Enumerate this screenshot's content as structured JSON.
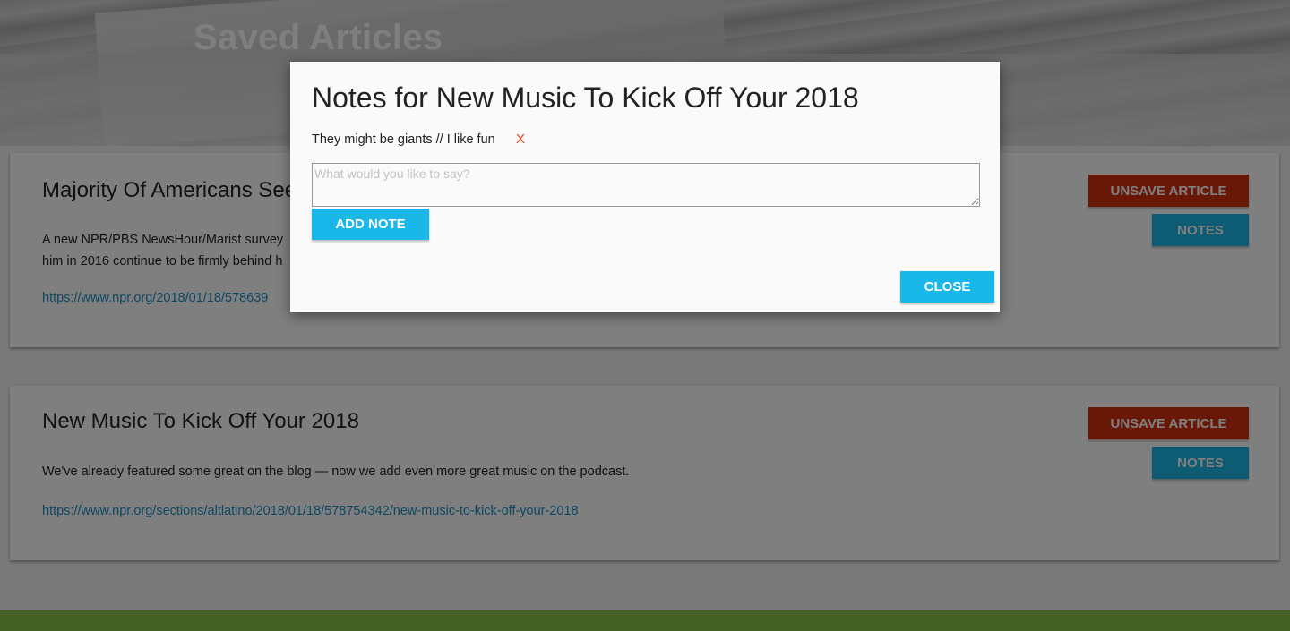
{
  "header": {
    "title": "Saved Articles"
  },
  "articles": [
    {
      "headline": "Majority Of Americans See",
      "summary": "A new NPR/PBS NewsHour/Marist survey",
      "summary_line2": "him in 2016 continue to be firmly behind h",
      "link": "https://www.npr.org/2018/01/18/578639",
      "unsave_label": "UNSAVE ARTICLE",
      "notes_label": "NOTES"
    },
    {
      "headline": "New Music To Kick Off Your 2018",
      "summary": "We've already featured some great on the blog — now we add even more great music on the podcast.",
      "link": "https://www.npr.org/sections/altlatino/2018/01/18/578754342/new-music-to-kick-off-your-2018",
      "unsave_label": "UNSAVE ARTICLE",
      "notes_label": "NOTES"
    }
  ],
  "modal": {
    "title": "Notes for New Music To Kick Off Your 2018",
    "notes": [
      {
        "text": "They might be giants // I like fun",
        "delete_label": "X"
      }
    ],
    "input_placeholder": "What would you like to say?",
    "add_label": "ADD NOTE",
    "close_label": "CLOSE"
  },
  "colors": {
    "accent_red": "#d32f0c",
    "accent_blue": "#1ab8e8",
    "footer_green": "#8bc34a",
    "link_blue": "#1a8fc4"
  }
}
